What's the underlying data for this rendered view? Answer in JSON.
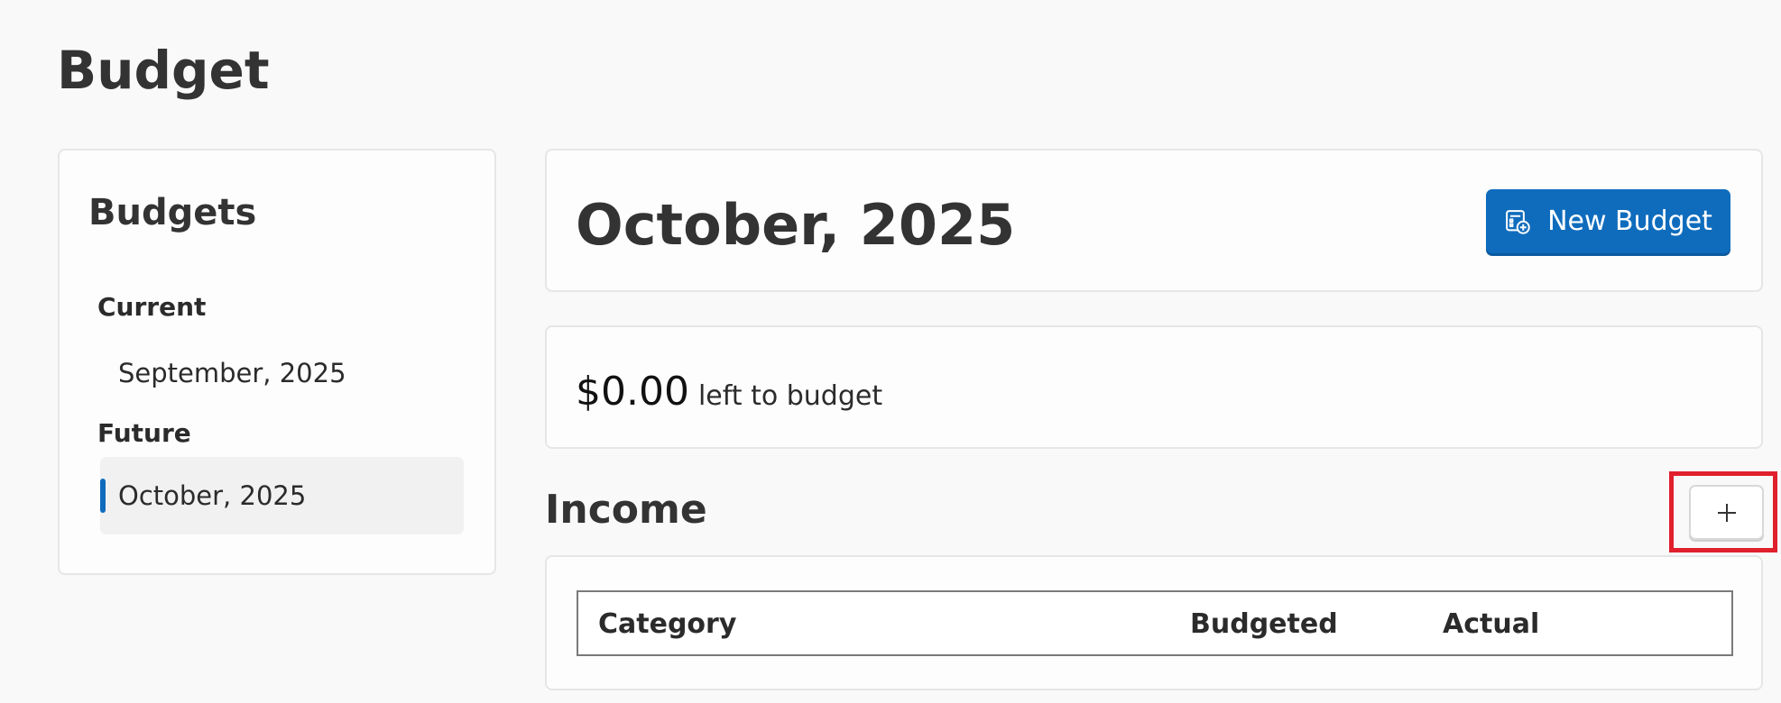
{
  "page": {
    "title": "Budget"
  },
  "sidebar": {
    "title": "Budgets",
    "groups": [
      {
        "label": "Current",
        "items": [
          {
            "label": "September, 2025",
            "selected": false
          }
        ]
      },
      {
        "label": "Future",
        "items": [
          {
            "label": "October, 2025",
            "selected": true
          }
        ]
      }
    ]
  },
  "header": {
    "month_title": "October, 2025",
    "new_budget_label": "New Budget",
    "new_budget_icon": "budget-add-icon"
  },
  "summary": {
    "amount": "$0.00",
    "label": "left to budget"
  },
  "income": {
    "title": "Income",
    "add_icon": "plus-icon",
    "columns": [
      "Category",
      "Budgeted",
      "Actual"
    ]
  },
  "colors": {
    "accent": "#0f6cbd",
    "highlight": "#e0202c",
    "background": "#f9f9f9"
  }
}
